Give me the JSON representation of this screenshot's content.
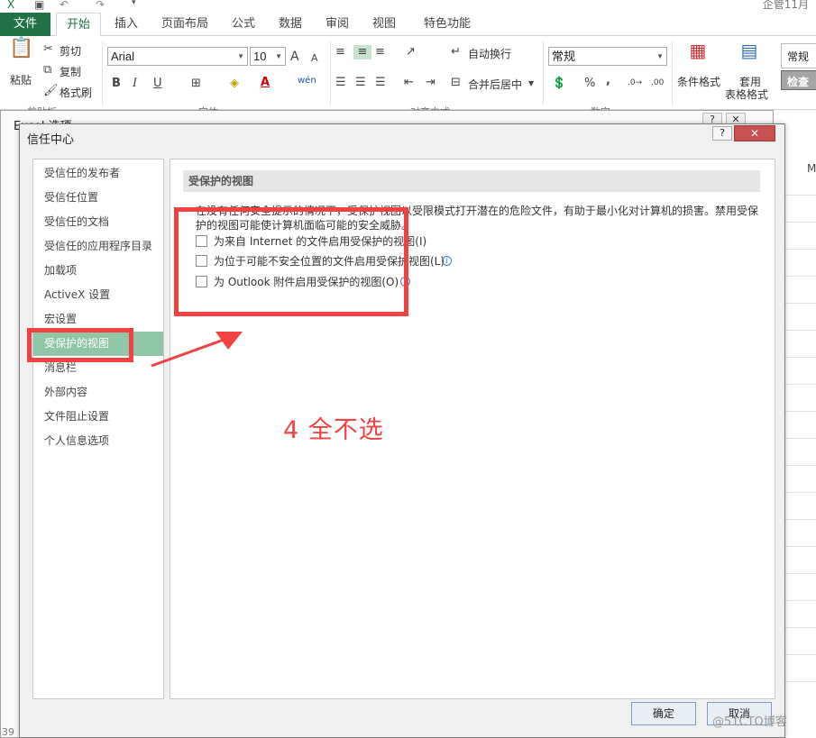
{
  "window": {
    "title": "企管11月"
  },
  "ribbon_tabs": [
    "文件",
    "开始",
    "插入",
    "页面布局",
    "公式",
    "数据",
    "审阅",
    "视图",
    "特色功能"
  ],
  "clipboard": {
    "paste": "粘贴",
    "cut": "剪切",
    "copy": "复制",
    "format_painter": "格式刷",
    "group": "剪贴板"
  },
  "font": {
    "name": "Arial",
    "size": "10",
    "bold": "B",
    "italic": "I",
    "underline": "U",
    "grow": "A",
    "shrink": "A",
    "wen": "wén",
    "group": "字体"
  },
  "alignment": {
    "wrap_text": "自动换行",
    "merge_center": "合并后居中",
    "group": "对齐方式"
  },
  "number": {
    "format": "常规",
    "percent": "%",
    "comma": ",",
    "group": "数字"
  },
  "styles": {
    "conditional": "条件格式",
    "table_format_1": "套用",
    "table_format_2": "表格格式",
    "style_normal": "常规",
    "style_check": "检查"
  },
  "back_dialog": {
    "title": "Excel 选项",
    "help": "?",
    "close": "✕"
  },
  "sheet": {
    "column_label": "M",
    "row_number": "39"
  },
  "dialog": {
    "title": "信任中心",
    "help": "?",
    "close": "✕",
    "nav_items": [
      "受信任的发布者",
      "受信任位置",
      "受信任的文档",
      "受信任的应用程序目录",
      "加载项",
      "ActiveX 设置",
      "宏设置",
      "受保护的视图",
      "消息栏",
      "外部内容",
      "文件阻止设置",
      "个人信息选项"
    ],
    "selected_nav": "受保护的视图",
    "section_title": "受保护的视图",
    "description_line1": "在没有任何安全提示的情况下，受保护视图以受限模式打开潜在的危险文件，有助于最小化对计算机的损害。禁用受保",
    "description_line2": "护的视图可能使计算机面临可能的安全威胁。",
    "options": [
      {
        "label": "为来自 Internet 的文件启用受保护的视图(I)",
        "checked": false
      },
      {
        "label": "为位于可能不安全位置的文件启用受保护视图(L)",
        "checked": false
      },
      {
        "label": "为 Outlook 附件启用受保护的视图(O)",
        "checked": false
      }
    ],
    "ok": "确定",
    "cancel": "取消"
  },
  "annotation": {
    "text": "4 全不选",
    "color": "#f24141"
  },
  "watermark": "@51CTO博客",
  "colors": {
    "excel_green": "#217346",
    "nav_selected": "#8fc7a6",
    "close_red": "#c75050"
  }
}
